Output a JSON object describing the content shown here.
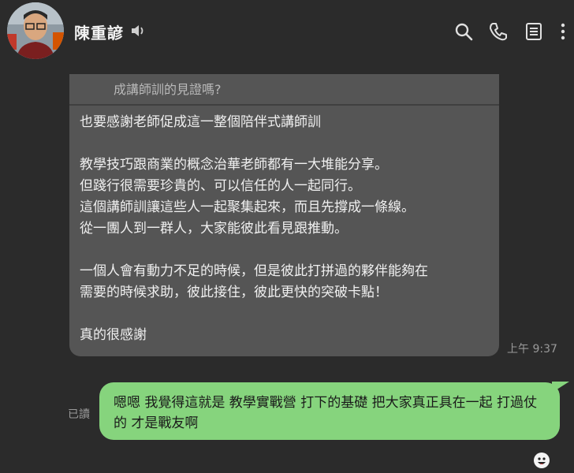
{
  "header": {
    "contact_name": "陳重諺",
    "icons": [
      "avatar",
      "speaker-icon",
      "search-icon",
      "phone-icon",
      "notes-icon",
      "more-icon"
    ]
  },
  "messages": {
    "incoming": {
      "quoted_text": "成講師訓的見證嗎?",
      "body": "也要感謝老師促成這一整個陪伴式講師訓\n\n教學技巧跟商業的概念治華老師都有一大堆能分享。\n但踐行很需要珍貴的、可以信任的人一起同行。\n這個講師訓讓這些人一起聚集起來，而且先撐成一條線。\n從一團人到一群人，大家能彼此看見跟推動。\n\n一個人會有動力不足的時候，但是彼此打拼過的夥伴能夠在\n需要的時候求助，彼此接住，彼此更快的突破卡點！\n\n真的很感謝",
      "time": "上午 9:37"
    },
    "outgoing": {
      "body": "嗯嗯 我覺得這就是 教學實戰營 打下的基礎 把大家真正具在一起 打過仗的 才是戰友啊",
      "read_label": "已讀"
    }
  },
  "colors": {
    "background": "#2b2b2b",
    "incoming_bubble": "#555555",
    "outgoing_bubble": "#86d47d"
  }
}
